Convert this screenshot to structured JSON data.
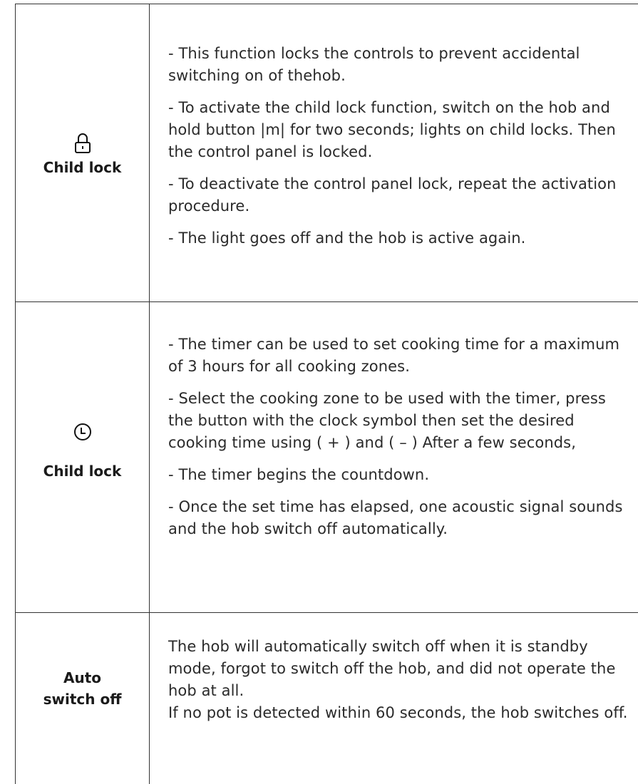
{
  "rows": [
    {
      "icon": "lock-icon",
      "label": "Child lock",
      "paragraphs": [
        "- This function locks the controls to prevent accidental switching on of thehob.",
        "- To activate the child lock function, switch on the hob and hold button |m| for two seconds; lights on child locks. Then the control panel is locked.",
        "- To deactivate the control panel lock, repeat the activation procedure.",
        "- The light goes off and the hob is active again."
      ]
    },
    {
      "icon": "clock-icon",
      "label": "Child lock",
      "paragraphs": [
        "- The timer can be used to set cooking time for a maximum of 3 hours for all cooking zones.",
        "- Select the cooking zone to be used with the timer, press the button with the clock symbol then set the desired cooking time using ( + )  and ( – ) After a few seconds,",
        "- The timer begins the countdown.",
        "- Once the set time has elapsed, one acoustic signal sounds and the hob switch off automatically."
      ]
    },
    {
      "label_line1": "Auto",
      "label_line2": "switch off",
      "paragraph_lines": [
        "The hob will automatically switch off when it is standby mode, forgot to switch off the hob, and did not operate the hob at all.",
        "If no pot is detected within 60 seconds, the hob switches off."
      ]
    }
  ]
}
